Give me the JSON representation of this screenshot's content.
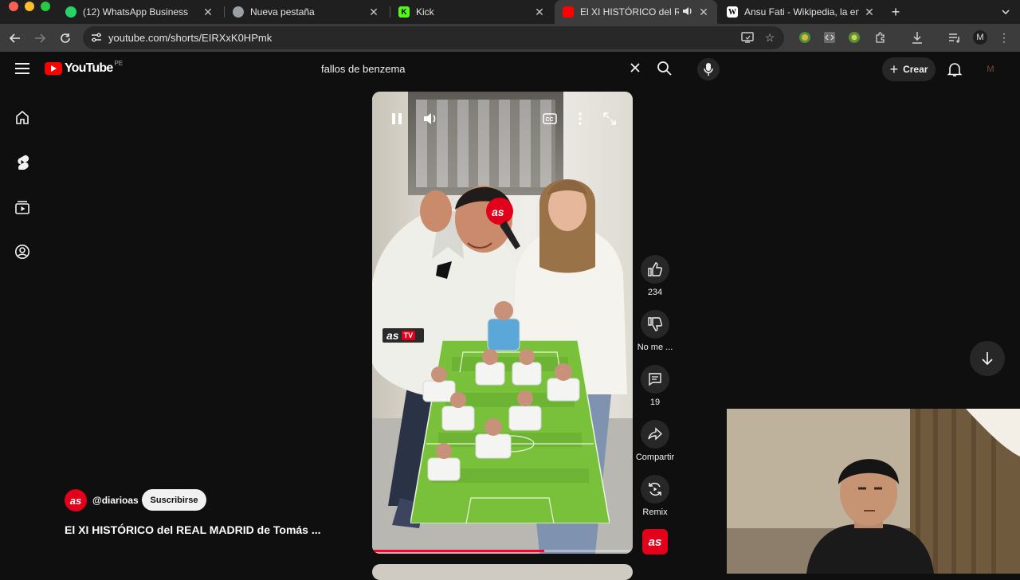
{
  "browser": {
    "tabs": [
      {
        "title": "(12) WhatsApp Business",
        "icon": "whatsapp-icon",
        "color": "#25d366"
      },
      {
        "title": "Nueva pestaña",
        "icon": "chrome-icon",
        "color": "#9aa0a6"
      },
      {
        "title": "Kick",
        "icon": "kick-icon",
        "color": "#53fc18"
      },
      {
        "title": "El XI HISTÓRICO del REAL",
        "icon": "youtube-icon",
        "color": "#ff0000",
        "active": true
      },
      {
        "title": "Ansu Fati - Wikipedia, la encic",
        "icon": "wikipedia-icon",
        "color": "#ffffff"
      }
    ],
    "url": "youtube.com/shorts/EIRXxK0HPmk"
  },
  "header": {
    "logo_text": "YouTube",
    "country_code": "PE",
    "search_query": "fallos de benzema",
    "create_label": "Crear",
    "avatar_initial": "M"
  },
  "short": {
    "progress": 0.66,
    "actions": {
      "likes": "234",
      "dislike_label": "No me ...",
      "comments": "19",
      "share_label": "Compartir",
      "remix_label": "Remix"
    },
    "channel": {
      "handle": "@diarioas",
      "avatar_text": "as",
      "subscribe_label": "Suscribirse"
    },
    "title": "El XI HISTÓRICO del REAL MADRID de Tomás ...",
    "overlay_logo": {
      "brand": "as",
      "tag": "TV"
    }
  },
  "colors": {
    "yt_red": "#ff0000",
    "as_red": "#e3001b",
    "pitch_green": "#79c13a",
    "background": "#0f0f0f"
  }
}
